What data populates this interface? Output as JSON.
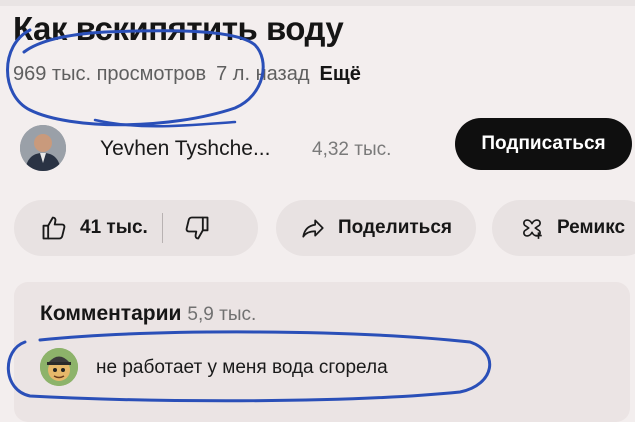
{
  "video": {
    "title": "Как вскипятить воду",
    "views": "969 тыс. просмотров",
    "age": "7 л. назад",
    "more": "Ещё"
  },
  "channel": {
    "name": "Yevhen Tyshche...",
    "subscribers": "4,32 тыс.",
    "subscribe_label": "Подписаться"
  },
  "actions": {
    "likes": "41 тыс.",
    "share_label": "Поделиться",
    "remix_label": "Ремикс"
  },
  "comments": {
    "title": "Комментарии",
    "count": "5,9 тыс.",
    "top_comment": "не работает у меня вода сгорела"
  },
  "icons": [
    "thumbs-up-icon",
    "thumbs-down-icon",
    "share-arrow-icon",
    "remix-icon"
  ],
  "colors": {
    "subscribe_bg": "#0f0f0f",
    "annotation": "#2a4fb8",
    "pill_bg": "#e8e2e2"
  }
}
